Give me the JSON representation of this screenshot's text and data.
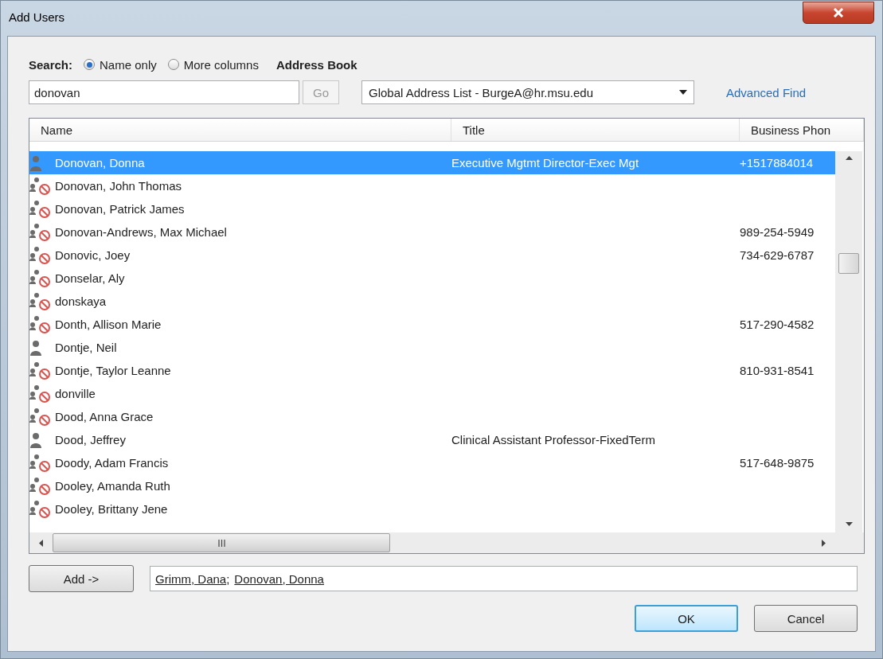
{
  "window": {
    "title": "Add Users"
  },
  "search": {
    "label": "Search:",
    "options": [
      {
        "label": "Name only",
        "selected": true
      },
      {
        "label": "More columns",
        "selected": false
      }
    ],
    "value": "donovan",
    "go_button": "Go",
    "go_disabled": true
  },
  "address_book": {
    "label": "Address Book",
    "value": "Global Address List - BurgeA@hr.msu.edu"
  },
  "advanced_find": "Advanced Find",
  "table": {
    "columns": [
      "Name",
      "Title",
      "Business Phon"
    ],
    "rows": [
      {
        "kind": "user",
        "name": "Donovan, Donna",
        "title": "Executive Mgtmt Director-Exec Mgt",
        "phone": "+1517884014",
        "selected": true
      },
      {
        "kind": "blocked",
        "name": "Donovan, John Thomas",
        "selected": false
      },
      {
        "kind": "blocked",
        "name": "Donovan, Patrick James",
        "selected": false
      },
      {
        "kind": "blocked",
        "name": "Donovan-Andrews, Max Michael",
        "phone": "989-254-5949",
        "selected": false
      },
      {
        "kind": "blocked",
        "name": "Donovic, Joey",
        "phone": "734-629-6787",
        "selected": false
      },
      {
        "kind": "blocked",
        "name": "Donselar, Aly",
        "selected": false
      },
      {
        "kind": "blocked",
        "name": "donskaya",
        "selected": false
      },
      {
        "kind": "blocked",
        "name": "Donth, Allison Marie",
        "phone": "517-290-4582",
        "selected": false
      },
      {
        "kind": "user",
        "name": "Dontje, Neil",
        "selected": false
      },
      {
        "kind": "blocked",
        "name": "Dontje, Taylor Leanne",
        "phone": "810-931-8541",
        "selected": false
      },
      {
        "kind": "blocked",
        "name": "donville",
        "selected": false
      },
      {
        "kind": "blocked",
        "name": "Dood, Anna Grace",
        "selected": false
      },
      {
        "kind": "user",
        "name": "Dood, Jeffrey",
        "title": "Clinical Assistant Professor-FixedTerm",
        "selected": false
      },
      {
        "kind": "blocked",
        "name": "Doody, Adam Francis",
        "phone": "517-648-9875",
        "selected": false
      },
      {
        "kind": "blocked",
        "name": "Dooley, Amanda Ruth",
        "selected": false
      },
      {
        "kind": "blocked",
        "name": "Dooley, Brittany Jene",
        "selected": false
      }
    ]
  },
  "add_button": "Add ->",
  "added": [
    {
      "name": "Grimm, Dana",
      "suffix": ";"
    },
    {
      "name": "Donovan, Donna"
    }
  ],
  "buttons": [
    {
      "label": "OK",
      "default": true
    },
    {
      "label": "Cancel",
      "default": false
    }
  ]
}
